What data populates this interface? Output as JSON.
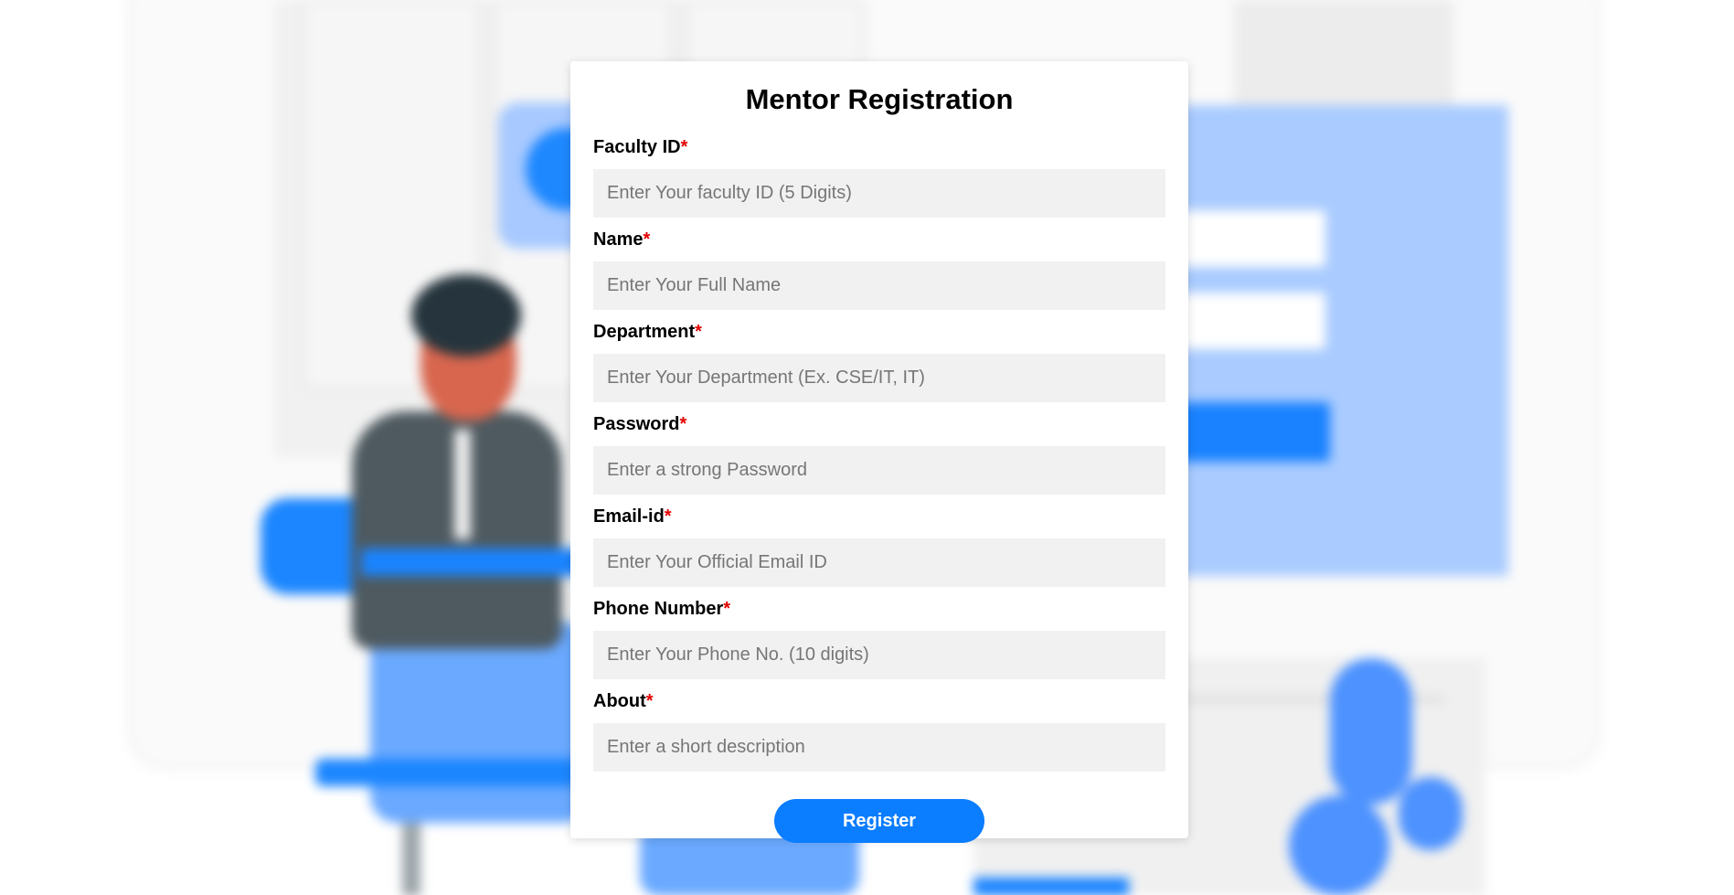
{
  "form": {
    "title": "Mentor Registration",
    "required_marker": "*",
    "fields": [
      {
        "label": "Faculty ID",
        "placeholder": "Enter Your faculty ID (5 Digits)",
        "value": ""
      },
      {
        "label": "Name",
        "placeholder": "Enter Your Full Name",
        "value": ""
      },
      {
        "label": "Department",
        "placeholder": "Enter Your Department (Ex. CSE/IT, IT)",
        "value": ""
      },
      {
        "label": "Password",
        "placeholder": "Enter a strong Password",
        "value": ""
      },
      {
        "label": "Email-id",
        "placeholder": "Enter Your Official Email ID",
        "value": ""
      },
      {
        "label": "Phone Number",
        "placeholder": "Enter Your Phone No. (10 digits)",
        "value": ""
      },
      {
        "label": "About",
        "placeholder": "Enter a short description",
        "value": ""
      }
    ],
    "submit_label": "Register"
  },
  "colors": {
    "accent": "#0b7dff",
    "required": "#e30000",
    "input_bg": "#f1f1f1"
  }
}
